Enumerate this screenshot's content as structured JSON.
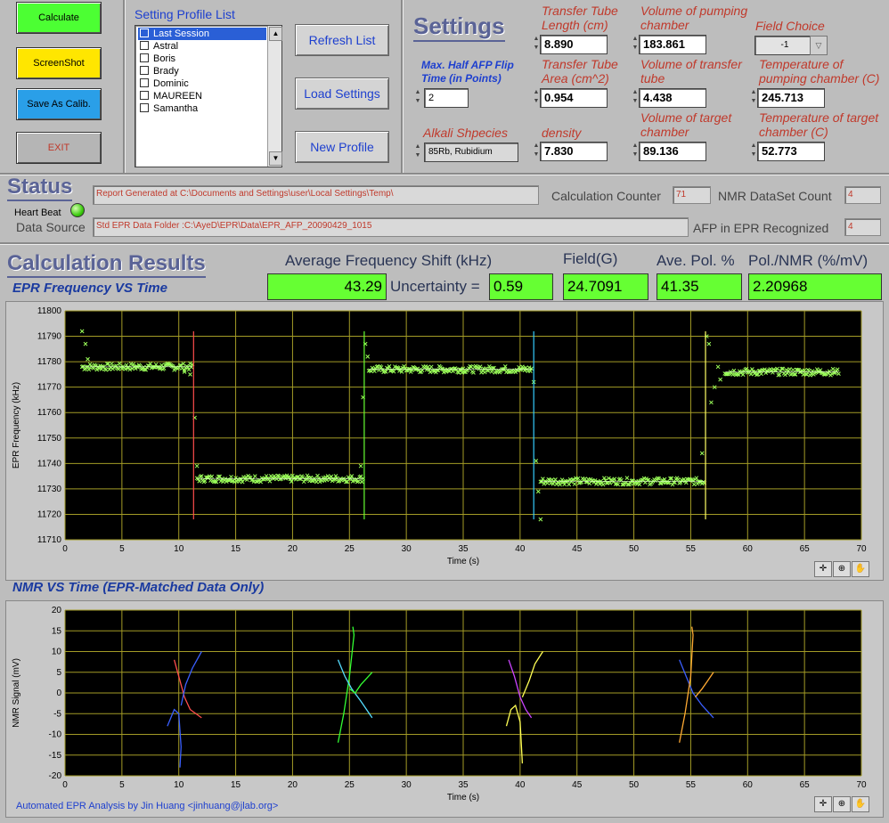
{
  "buttons": {
    "calculate": "Calculate",
    "screenshot": "ScreenShot",
    "save_calib": "Save As Calib.",
    "exit": "EXIT",
    "refresh_list": "Refresh List",
    "load_settings": "Load Settings",
    "new_profile": "New Profile"
  },
  "colors": {
    "calc_btn": "#4cff33",
    "shot_btn": "#ffe600",
    "save_btn": "#2a9fe8",
    "exit_btn": "#b5b5b5",
    "result_green": "#66ff33"
  },
  "profile_list": {
    "title": "Setting Profile List",
    "items": [
      "Last Session",
      "Astral",
      "Boris",
      "Brady",
      "Dominic",
      "MAUREEN",
      "Samantha"
    ],
    "selected_index": 0
  },
  "settings": {
    "title": "Settings",
    "max_half_afp_label": "Max. Half AFP Flip Time (in Points)",
    "max_half_afp_value": "2",
    "alkali_label": "Alkali Shpecies",
    "alkali_value": "85Rb, Rubidium",
    "transfer_tube_length_label": "Transfer Tube Length (cm)",
    "transfer_tube_length": "8.890",
    "transfer_tube_area_label": "Transfer Tube Area (cm^2)",
    "transfer_tube_area": "0.954",
    "density_label": "density",
    "density": "7.830",
    "vol_pumping_label": "Volume of pumping chamber",
    "vol_pumping": "183.861",
    "vol_transfer_label": "Volume of transfer tube",
    "vol_transfer": "4.438",
    "vol_target_label": "Volume of target chamber",
    "vol_target": "89.136",
    "field_choice_label": "Field Choice",
    "field_choice": "-1",
    "temp_pumping_label": "Temperature of pumping chamber (C)",
    "temp_pumping": "245.713",
    "temp_target_label": "Temperature of target chamber (C)",
    "temp_target": "52.773"
  },
  "status": {
    "title": "Status",
    "report_text": "Report Generated at C:\\Documents and Settings\\user\\Local Settings\\Temp\\",
    "heartbeat_label": "Heart Beat",
    "data_source_label": "Data Source",
    "data_source_text": "Std EPR Data Folder :C:\\AyeD\\EPR\\Data\\EPR_AFP_20090429_1015",
    "calc_counter_label": "Calculation Counter",
    "calc_counter": "71",
    "nmr_count_label": "NMR DataSet Count",
    "nmr_count": "4",
    "afp_label": "AFP in EPR Recognized",
    "afp_count": "4"
  },
  "results": {
    "title": "Calculation Results",
    "avg_freq_label": "Average Frequency Shift (kHz)",
    "avg_freq": "43.29",
    "uncertainty_label": "Uncertainty =",
    "uncertainty": "0.59",
    "field_label": "Field(G)",
    "field": "24.7091",
    "ave_pol_label": "Ave. Pol. %",
    "ave_pol": "41.35",
    "pol_nmr_label": "Pol./NMR (%/mV)",
    "pol_nmr": "2.20968"
  },
  "epr_plot": {
    "title": "EPR Frequency VS Time",
    "xlabel": "Time (s)",
    "ylabel": "EPR Frequency (kHz)"
  },
  "nmr_plot": {
    "title": "NMR VS Time (EPR-Matched Data Only)",
    "xlabel": "Time (s)",
    "ylabel": "NMR Signal (mV)"
  },
  "footer": "Automated EPR Analysis by Jin Huang <jinhuang@jlab.org>",
  "chart_data": [
    {
      "type": "scatter",
      "name": "epr",
      "xlim": [
        0,
        70
      ],
      "ylim": [
        11710,
        11800
      ],
      "xticks": [
        0,
        5,
        10,
        15,
        20,
        25,
        30,
        35,
        40,
        45,
        50,
        55,
        60,
        65,
        70
      ],
      "yticks": [
        11710,
        11720,
        11730,
        11740,
        11750,
        11760,
        11770,
        11780,
        11790,
        11800
      ],
      "segments": [
        {
          "x0": 1.5,
          "x1": 11.2,
          "level": 11778,
          "spikes": [
            [
              1.5,
              11792
            ],
            [
              1.8,
              11787
            ],
            [
              2.0,
              11781
            ],
            [
              10.5,
              11776
            ],
            [
              11.0,
              11775
            ]
          ]
        },
        {
          "x0": 11.6,
          "x1": 26.2,
          "level": 11734,
          "spikes": [
            [
              11.4,
              11758
            ],
            [
              11.6,
              11739
            ],
            [
              26.0,
              11739
            ]
          ]
        },
        {
          "x0": 26.7,
          "x1": 41.0,
          "level": 11777,
          "spikes": [
            [
              26.2,
              11766
            ],
            [
              26.4,
              11787
            ],
            [
              26.6,
              11782
            ],
            [
              41.2,
              11772
            ]
          ]
        },
        {
          "x0": 41.8,
          "x1": 56.2,
          "level": 11733,
          "spikes": [
            [
              41.4,
              11741
            ],
            [
              41.6,
              11729
            ],
            [
              41.8,
              11718
            ],
            [
              56.0,
              11744
            ]
          ]
        },
        {
          "x0": 58.0,
          "x1": 68.0,
          "level": 11776,
          "spikes": [
            [
              56.4,
              11790
            ],
            [
              56.6,
              11787
            ],
            [
              56.8,
              11764
            ],
            [
              57.1,
              11770
            ],
            [
              57.4,
              11778
            ],
            [
              57.6,
              11773
            ]
          ]
        }
      ],
      "afp_lines": [
        {
          "x": 11.3,
          "color": "#ff4d4d"
        },
        {
          "x": 26.3,
          "color": "#66ff33"
        },
        {
          "x": 41.2,
          "color": "#33ccff"
        },
        {
          "x": 56.3,
          "color": "#ffff66"
        }
      ],
      "afp_y_range": [
        11718,
        11792
      ]
    },
    {
      "type": "line",
      "name": "nmr",
      "xlim": [
        0,
        70
      ],
      "ylim": [
        -20,
        20
      ],
      "xticks": [
        0,
        5,
        10,
        15,
        20,
        25,
        30,
        35,
        40,
        45,
        50,
        55,
        60,
        65,
        70
      ],
      "yticks": [
        -20,
        -15,
        -10,
        -5,
        0,
        5,
        10,
        15,
        20
      ],
      "curves": [
        {
          "color": "#ff4d4d",
          "points": [
            [
              9.6,
              8
            ],
            [
              10,
              4
            ],
            [
              10.5,
              -1
            ],
            [
              11,
              -4
            ],
            [
              12,
              -6
            ]
          ]
        },
        {
          "color": "#3a5fff",
          "points": [
            [
              9,
              -8
            ],
            [
              9.6,
              -4
            ],
            [
              10,
              -5
            ],
            [
              10.2,
              -13
            ],
            [
              10.1,
              -18
            ]
          ]
        },
        {
          "color": "#3a5fff",
          "points": [
            [
              10.2,
              -3
            ],
            [
              10.6,
              2
            ],
            [
              11.2,
              6
            ],
            [
              12,
              10
            ]
          ]
        },
        {
          "color": "#33ff33",
          "points": [
            [
              24,
              -12
            ],
            [
              24.5,
              -5
            ],
            [
              25,
              4
            ],
            [
              25.4,
              14
            ],
            [
              25.3,
              16
            ]
          ]
        },
        {
          "color": "#55ddff",
          "points": [
            [
              24,
              8
            ],
            [
              24.6,
              4
            ],
            [
              25.2,
              1
            ],
            [
              26,
              -2
            ],
            [
              27,
              -6
            ]
          ]
        },
        {
          "color": "#33ff33",
          "points": [
            [
              25,
              1
            ],
            [
              25.5,
              0
            ],
            [
              26,
              2
            ],
            [
              27,
              5
            ]
          ]
        },
        {
          "color": "#cc44ff",
          "points": [
            [
              39,
              8
            ],
            [
              39.5,
              4
            ],
            [
              40,
              -1
            ],
            [
              40.5,
              -4
            ],
            [
              41,
              -6
            ]
          ]
        },
        {
          "color": "#ffff55",
          "points": [
            [
              38.8,
              -8
            ],
            [
              39.2,
              -4
            ],
            [
              39.6,
              -3
            ],
            [
              40,
              -7
            ],
            [
              40.2,
              -17
            ]
          ]
        },
        {
          "color": "#ffff55",
          "points": [
            [
              40.2,
              -1
            ],
            [
              40.8,
              3
            ],
            [
              41.3,
              7
            ],
            [
              42,
              10
            ]
          ]
        },
        {
          "color": "#3a5fff",
          "points": [
            [
              54,
              8
            ],
            [
              54.6,
              4
            ],
            [
              55.2,
              0
            ],
            [
              56,
              -3
            ],
            [
              57,
              -6
            ]
          ]
        },
        {
          "color": "#ffaa33",
          "points": [
            [
              54,
              -12
            ],
            [
              54.5,
              -5
            ],
            [
              55,
              4
            ],
            [
              55.2,
              14
            ],
            [
              55.1,
              16
            ]
          ]
        },
        {
          "color": "#ffaa33",
          "points": [
            [
              55.4,
              -1
            ],
            [
              56,
              1
            ],
            [
              56.5,
              3
            ],
            [
              57,
              5
            ]
          ]
        }
      ]
    }
  ]
}
